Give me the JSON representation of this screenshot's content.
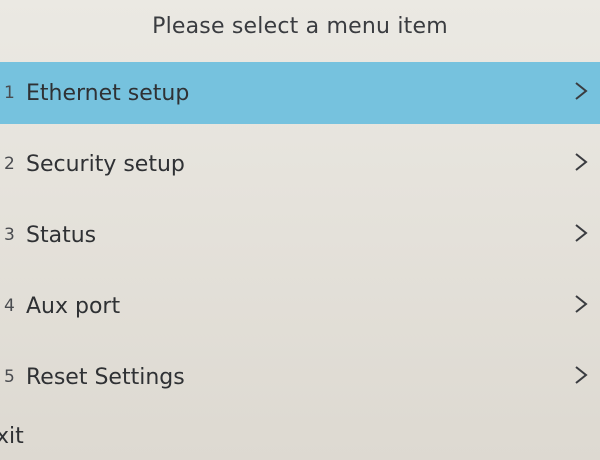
{
  "header": {
    "title": "Please select a menu item"
  },
  "menu": {
    "items": [
      {
        "num": "1",
        "label": "Ethernet setup",
        "selected": true
      },
      {
        "num": "2",
        "label": "Security setup",
        "selected": false
      },
      {
        "num": "3",
        "label": "Status",
        "selected": false
      },
      {
        "num": "4",
        "label": "Aux port",
        "selected": false
      },
      {
        "num": "5",
        "label": "Reset Settings",
        "selected": false
      }
    ],
    "chevron_icon": "chevron-right-icon"
  },
  "footer": {
    "exit_label": "xit"
  },
  "colors": {
    "selected_bg": "#76c2de",
    "screen_bg": "#e6e3dc",
    "text": "#2f3134"
  }
}
